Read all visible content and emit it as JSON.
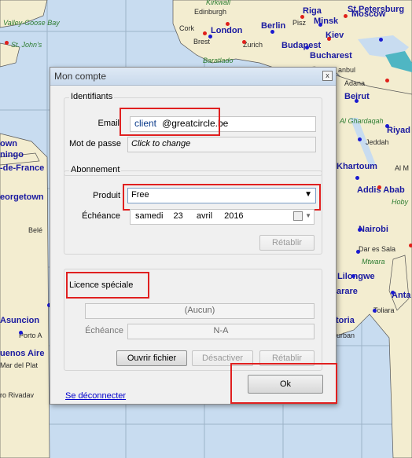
{
  "map": {
    "cities": [
      {
        "name": "Kirkwall",
        "cls": "green"
      },
      {
        "name": "Valley-Goose Bay",
        "cls": "green"
      },
      {
        "name": "Edinburgh",
        "cls": "small"
      },
      {
        "name": "Riga",
        "cls": ""
      },
      {
        "name": "St Petersburg",
        "cls": ""
      },
      {
        "name": "Cork",
        "cls": "small"
      },
      {
        "name": "London",
        "cls": ""
      },
      {
        "name": "Berlin",
        "cls": ""
      },
      {
        "name": "Pisz",
        "cls": "small"
      },
      {
        "name": "Minsk",
        "cls": ""
      },
      {
        "name": "Moscow",
        "cls": ""
      },
      {
        "name": "St. John's",
        "cls": "green"
      },
      {
        "name": "Brest",
        "cls": "small"
      },
      {
        "name": "Kiev",
        "cls": ""
      },
      {
        "name": "Zurich",
        "cls": "small"
      },
      {
        "name": "Budapest",
        "cls": ""
      },
      {
        "name": "Baratlado",
        "cls": "green"
      },
      {
        "name": "Bucharest",
        "cls": ""
      },
      {
        "name": "anbul",
        "cls": "small"
      },
      {
        "name": "Adana",
        "cls": "small"
      },
      {
        "name": "Beirut",
        "cls": ""
      },
      {
        "name": "Al Ghardaqah",
        "cls": "green"
      },
      {
        "name": "Riyad",
        "cls": ""
      },
      {
        "name": "Jeddah",
        "cls": "small"
      },
      {
        "name": "own",
        "cls": ""
      },
      {
        "name": "ningo",
        "cls": ""
      },
      {
        "name": "-de-France",
        "cls": ""
      },
      {
        "name": "Khartoum",
        "cls": ""
      },
      {
        "name": "Al M",
        "cls": "small"
      },
      {
        "name": "Addis Abab",
        "cls": ""
      },
      {
        "name": "eorgetown",
        "cls": ""
      },
      {
        "name": "Hoby",
        "cls": "green"
      },
      {
        "name": "Nairobi",
        "cls": ""
      },
      {
        "name": "Belé",
        "cls": "small"
      },
      {
        "name": "Dar es Sala",
        "cls": "small"
      },
      {
        "name": "Mtwara",
        "cls": "green"
      },
      {
        "name": "Lilongwe",
        "cls": ""
      },
      {
        "name": "arare",
        "cls": ""
      },
      {
        "name": "Anta",
        "cls": ""
      },
      {
        "name": "Toliara",
        "cls": "small"
      },
      {
        "name": "toria",
        "cls": ""
      },
      {
        "name": "Asuncion",
        "cls": ""
      },
      {
        "name": "Porto A",
        "cls": "small"
      },
      {
        "name": "urban",
        "cls": "small"
      },
      {
        "name": "uenos Aire",
        "cls": ""
      },
      {
        "name": "Mar del Plat",
        "cls": "small"
      },
      {
        "name": "ro Rivadav",
        "cls": "small"
      }
    ]
  },
  "dialog": {
    "title": "Mon compte",
    "close_glyph": "x",
    "identifiants": {
      "group_title": "Identifiants",
      "email_label": "Email",
      "email_prefix": "client",
      "email_domain": "@greatcircle.be",
      "password_label": "Mot de passe",
      "password_value": "Click to change"
    },
    "abonnement": {
      "group_title": "Abonnement",
      "produit_label": "Produit",
      "produit_value": "Free",
      "echeance_label": "Échéance",
      "date_day": "samedi",
      "date_num": "23",
      "date_month": "avril",
      "date_year": "2016",
      "retablir_label": "Rétablir"
    },
    "licence": {
      "group_title": "Licence spéciale",
      "aucun_value": "(Aucun)",
      "echeance_label": "Échéance",
      "echeance_value": "N-A",
      "ouvrir_label": "Ouvrir fichier",
      "desactiver_label": "Désactiver",
      "retablir_label": "Rétablir"
    },
    "logout_label": "Se déconnecter",
    "ok_label": "Ok"
  }
}
